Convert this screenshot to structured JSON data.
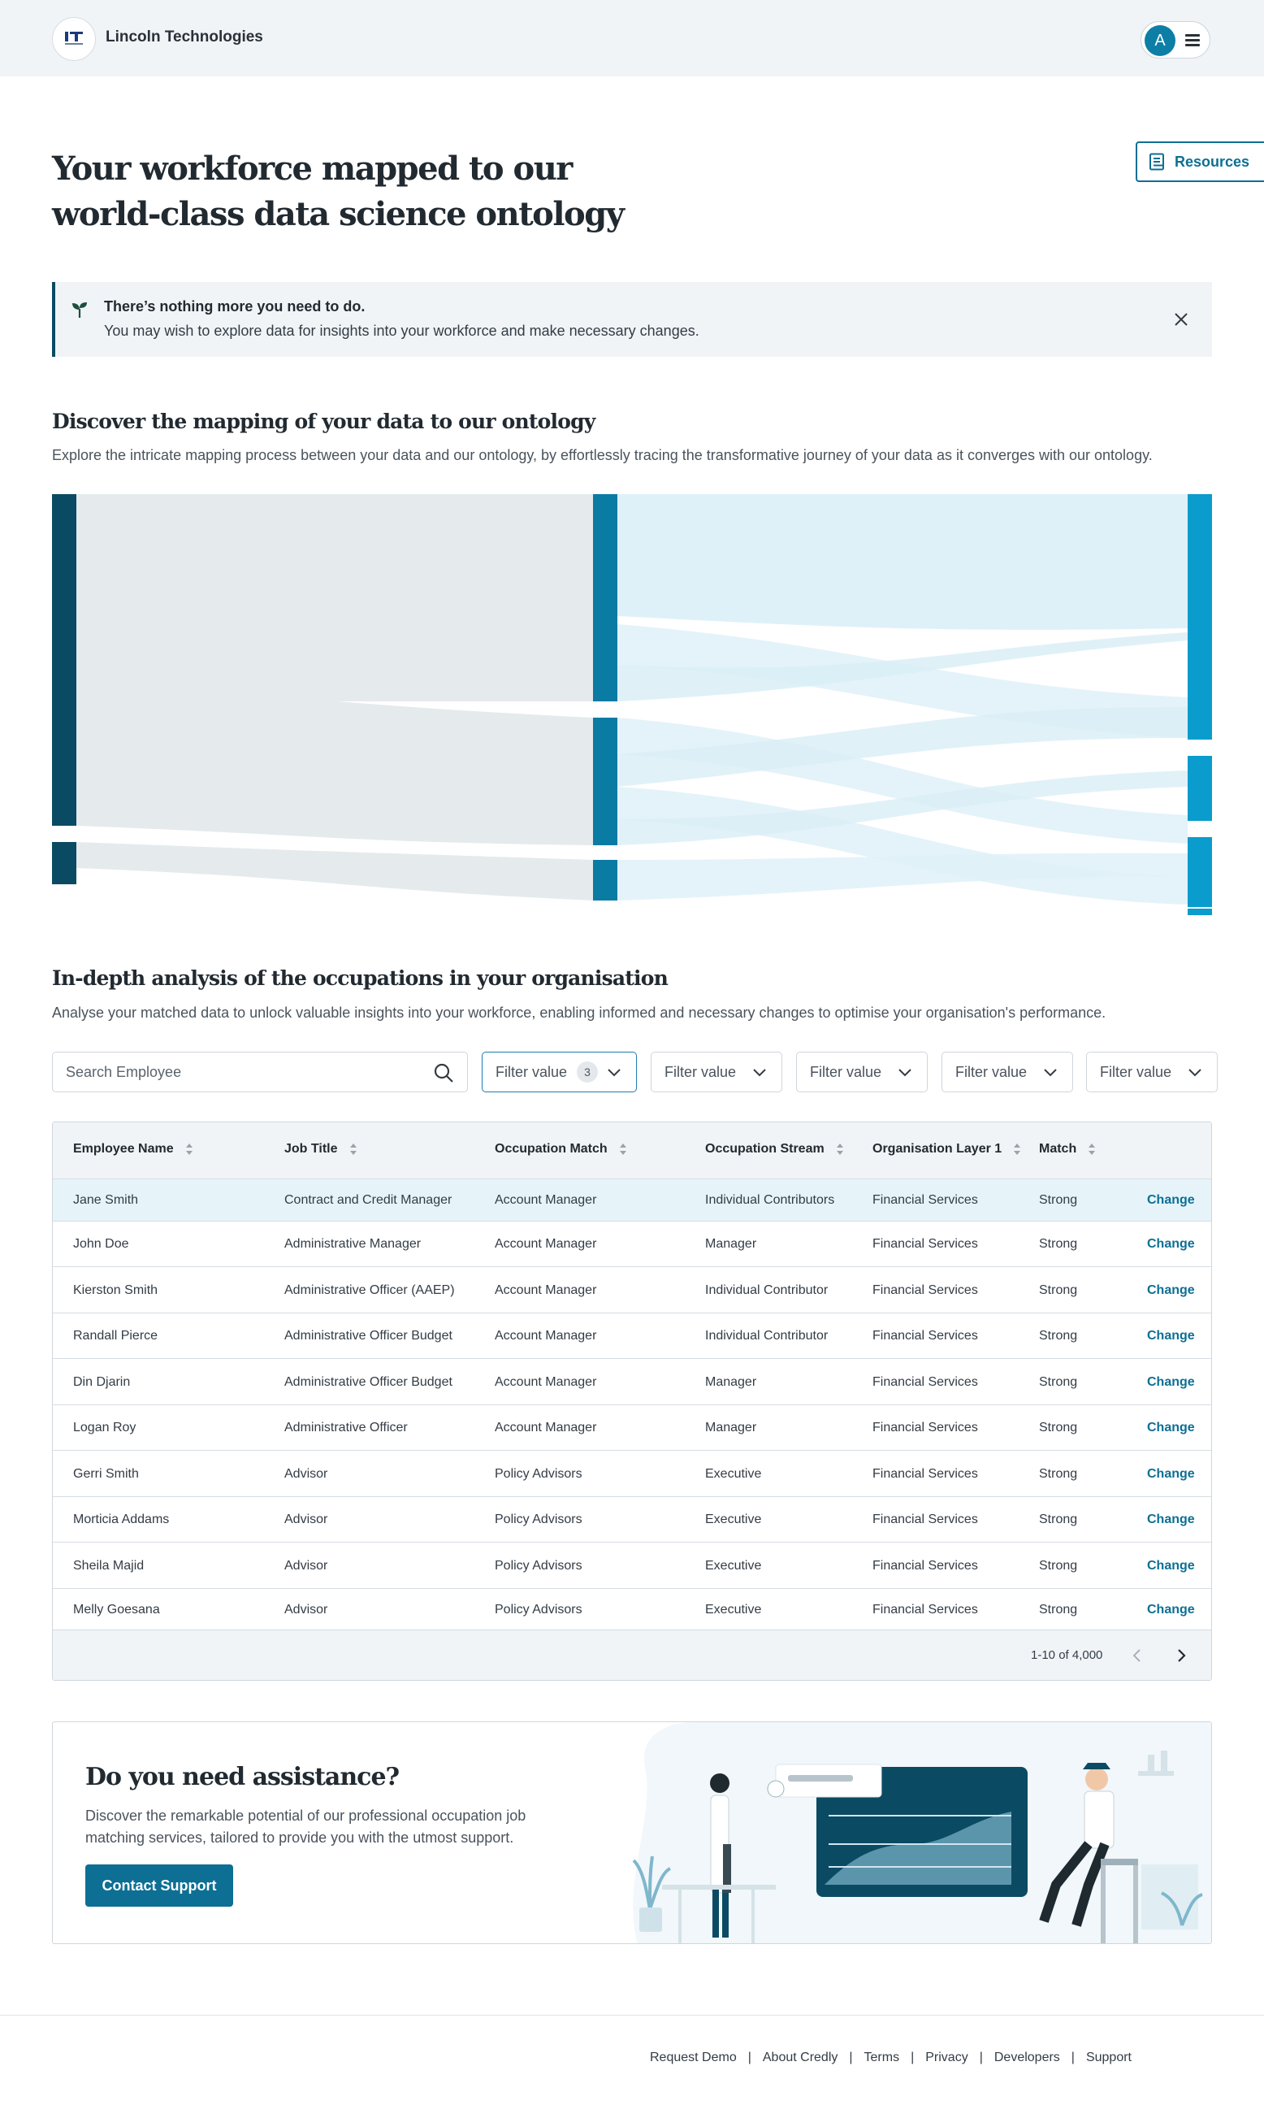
{
  "header": {
    "company": "Lincoln Technologies",
    "avatar_initial": "A"
  },
  "resources_label": "Resources",
  "hero": {
    "line1": "Your workforce mapped to our",
    "line2": "world-class data science ontology"
  },
  "notice": {
    "title": "There’s nothing more you need to do.",
    "body": "You may wish to explore data for insights into your workforce and make necessary changes."
  },
  "mapping": {
    "title": "Discover the mapping of your data to our ontology",
    "desc": "Explore the intricate mapping process between your data and our ontology, by effortlessly tracing the transformative journey of your data as it converges with our ontology."
  },
  "analysis": {
    "title": "In-depth analysis of the occupations in your organisation",
    "desc": "Analyse your matched data to unlock valuable insights into your workforce, enabling informed and necessary changes to optimise your organisation's performance."
  },
  "search": {
    "placeholder": "Search Employee"
  },
  "filters": [
    {
      "label": "Filter value",
      "count": "3"
    },
    {
      "label": "Filter value"
    },
    {
      "label": "Filter value"
    },
    {
      "label": "Filter value"
    },
    {
      "label": "Filter value"
    }
  ],
  "table": {
    "columns": [
      "Employee Name",
      "Job Title",
      "Occupation Match",
      "Occupation Stream",
      "Organisation Layer 1",
      "Match"
    ],
    "action_label": "Change",
    "rows": [
      [
        "Jane Smith",
        "Contract and Credit Manager",
        "Account Manager",
        "Individual Contributors",
        "Financial Services",
        "Strong"
      ],
      [
        "John Doe",
        "Administrative Manager",
        "Account Manager",
        "Manager",
        "Financial Services",
        "Strong"
      ],
      [
        "Kierston Smith",
        "Administrative Officer (AAEP)",
        "Account Manager",
        "Individual Contributor",
        "Financial Services",
        "Strong"
      ],
      [
        "Randall Pierce",
        "Administrative Officer Budget",
        "Account Manager",
        "Individual Contributor",
        "Financial Services",
        "Strong"
      ],
      [
        "Din Djarin",
        "Administrative Officer Budget",
        "Account Manager",
        "Manager",
        "Financial Services",
        "Strong"
      ],
      [
        "Logan Roy",
        "Administrative Officer",
        "Account Manager",
        "Manager",
        "Financial Services",
        "Strong"
      ],
      [
        "Gerri Smith",
        "Advisor",
        "Policy Advisors",
        "Executive",
        "Financial Services",
        "Strong"
      ],
      [
        "Morticia Addams",
        "Advisor",
        "Policy Advisors",
        "Executive",
        "Financial Services",
        "Strong"
      ],
      [
        "Sheila Majid",
        "Advisor",
        "Policy Advisors",
        "Executive",
        "Financial Services",
        "Strong"
      ],
      [
        "Melly Goesana",
        "Advisor",
        "Policy Advisors",
        "Executive",
        "Financial Services",
        "Strong"
      ]
    ],
    "pagination": "1-10 of 4,000"
  },
  "assist": {
    "title": "Do you need assistance?",
    "desc": "Discover the remarkable potential of our professional occupation job matching services, tailored to provide you with the utmost support.",
    "button": "Contact Support"
  },
  "footer": {
    "links": [
      "Request Demo",
      "About Credly",
      "Terms",
      "Privacy",
      "Developers",
      "Support"
    ]
  },
  "colors": {
    "accent": "#0d6f94",
    "sankey_left": "#0b4a63",
    "sankey_mid": "#0a7ba3",
    "sankey_right": "#0a9ccc",
    "flow_grey": "#e5eaed",
    "flow_blue": "#dff1f8"
  }
}
